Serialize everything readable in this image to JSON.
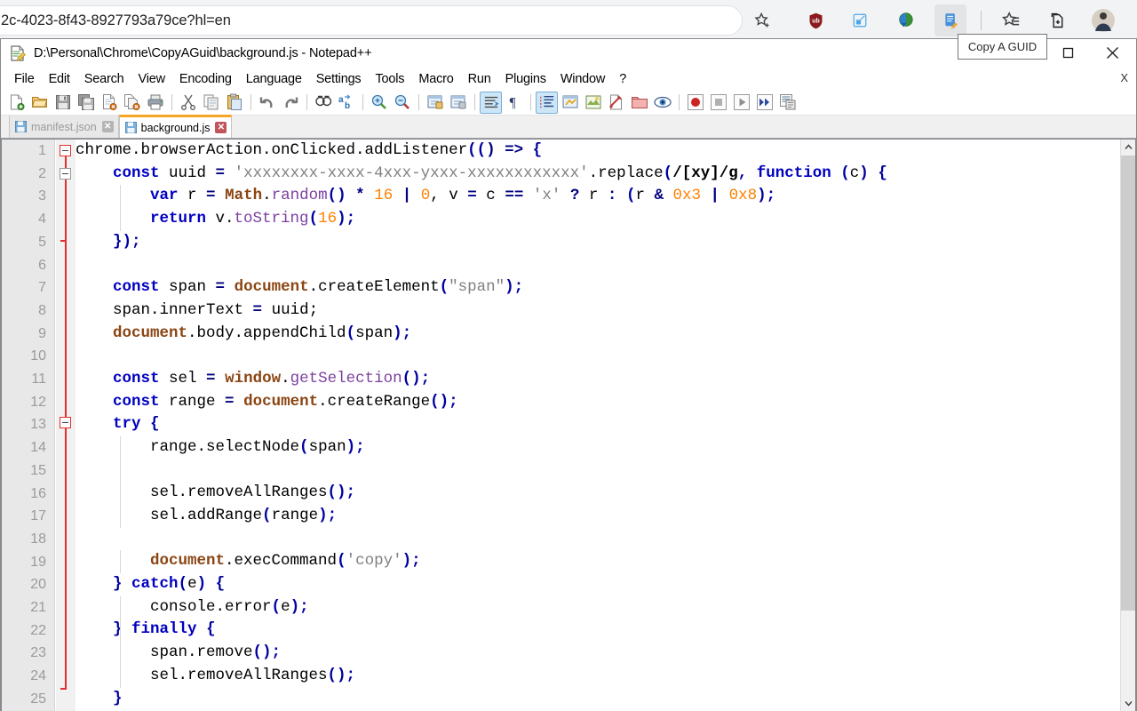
{
  "browser": {
    "omnibox_value": "2c-4023-8f43-8927793a79ce?hl=en",
    "toolbar_icons": [
      {
        "name": "bookmark-star-icon",
        "glyph": "☆"
      },
      {
        "name": "ublock-origin-shield-icon",
        "glyph": "ub"
      },
      {
        "name": "extension-blue-icon",
        "glyph": "▣"
      },
      {
        "name": "internet-download-manager-icon",
        "glyph": "◕"
      },
      {
        "name": "copy-a-guid-extension-icon",
        "glyph": "✎"
      },
      {
        "name": "reading-list-star-icon",
        "glyph": "☆≡"
      },
      {
        "name": "collections-icon",
        "glyph": "⧉"
      },
      {
        "name": "profile-avatar-icon",
        "glyph": "●"
      }
    ],
    "tooltip_text": "Copy A GUID"
  },
  "npp": {
    "title": "D:\\Personal\\Chrome\\CopyAGuid\\background.js - Notepad++",
    "window_buttons": {
      "maximize": "▢",
      "close": "✕",
      "menubar_close": "X"
    },
    "menu": [
      "File",
      "Edit",
      "Search",
      "View",
      "Encoding",
      "Language",
      "Settings",
      "Tools",
      "Macro",
      "Run",
      "Plugins",
      "Window",
      "?"
    ],
    "toolbar": [
      {
        "name": "new-file-button",
        "group": 1
      },
      {
        "name": "open-file-button",
        "group": 1
      },
      {
        "name": "save-button",
        "group": 1
      },
      {
        "name": "save-all-button",
        "group": 1
      },
      {
        "name": "close-file-button",
        "group": 1
      },
      {
        "name": "close-all-files-button",
        "group": 1
      },
      {
        "name": "print-button",
        "group": 1
      },
      {
        "name": "cut-button",
        "group": 2
      },
      {
        "name": "copy-button",
        "group": 2
      },
      {
        "name": "paste-button",
        "group": 2
      },
      {
        "name": "undo-button",
        "group": 3
      },
      {
        "name": "redo-button",
        "group": 3
      },
      {
        "name": "find-button",
        "group": 4
      },
      {
        "name": "replace-button",
        "group": 4
      },
      {
        "name": "zoom-in-button",
        "group": 5
      },
      {
        "name": "zoom-out-button",
        "group": 5
      },
      {
        "name": "sync-vertical-scrolling-button",
        "group": 6
      },
      {
        "name": "sync-horizontal-scrolling-button",
        "group": 6
      },
      {
        "name": "word-wrap-button",
        "group": 7
      },
      {
        "name": "show-all-characters-button",
        "group": 7
      },
      {
        "name": "indent-guideline-button",
        "group": 8
      },
      {
        "name": "user-defined-dialog-button",
        "group": 8
      },
      {
        "name": "document-map-button",
        "group": 8
      },
      {
        "name": "function-list-button",
        "group": 8
      },
      {
        "name": "folder-as-workspace-button",
        "group": 8
      },
      {
        "name": "monitoring-button",
        "group": 8
      },
      {
        "name": "record-macro-button",
        "group": 9
      },
      {
        "name": "stop-recording-button",
        "group": 9
      },
      {
        "name": "playback-button",
        "group": 9
      },
      {
        "name": "run-multiple-macro-button",
        "group": 9
      },
      {
        "name": "save-current-macro-button",
        "group": 9
      }
    ],
    "tabs": [
      {
        "label": "manifest.json",
        "active": false
      },
      {
        "label": "background.js",
        "active": true
      }
    ],
    "scrollbar": {
      "up_glyph": "⌃",
      "down_glyph": "⌄"
    }
  },
  "editor": {
    "line_numbers": [
      1,
      2,
      3,
      4,
      5,
      6,
      7,
      8,
      9,
      10,
      11,
      12,
      13,
      14,
      15,
      16,
      17,
      18,
      19,
      20,
      21,
      22,
      23,
      24,
      25
    ],
    "lines": [
      "chrome.browserAction.onClicked.addListener(() => {",
      "    const uuid = 'xxxxxxxx-xxxx-4xxx-yxxx-xxxxxxxxxxxx'.replace(/[xy]/g, function (c) {",
      "        var r = Math.random() * 16 | 0, v = c == 'x' ? r : (r & 0x3 | 0x8);",
      "        return v.toString(16);",
      "    });",
      "",
      "    const span = document.createElement(\"span\");",
      "    span.innerText = uuid;",
      "    document.body.appendChild(span);",
      "",
      "    const sel = window.getSelection();",
      "    const range = document.createRange();",
      "    try {",
      "        range.selectNode(span);",
      "",
      "        sel.removeAllRanges();",
      "        sel.addRange(range);",
      "",
      "        document.execCommand('copy');",
      "    } catch(e) {",
      "        console.error(e);",
      "    } finally {",
      "        span.remove();",
      "        sel.removeAllRanges();",
      "    }"
    ]
  },
  "colors": {
    "keyword": "#0000c0",
    "object": "#8b4513",
    "method": "#7b3fa0",
    "string": "#808080",
    "number": "#ff8000",
    "operator": "#000080",
    "active_tab_accent": "#f5a623",
    "fold_rail": "#e03030"
  }
}
